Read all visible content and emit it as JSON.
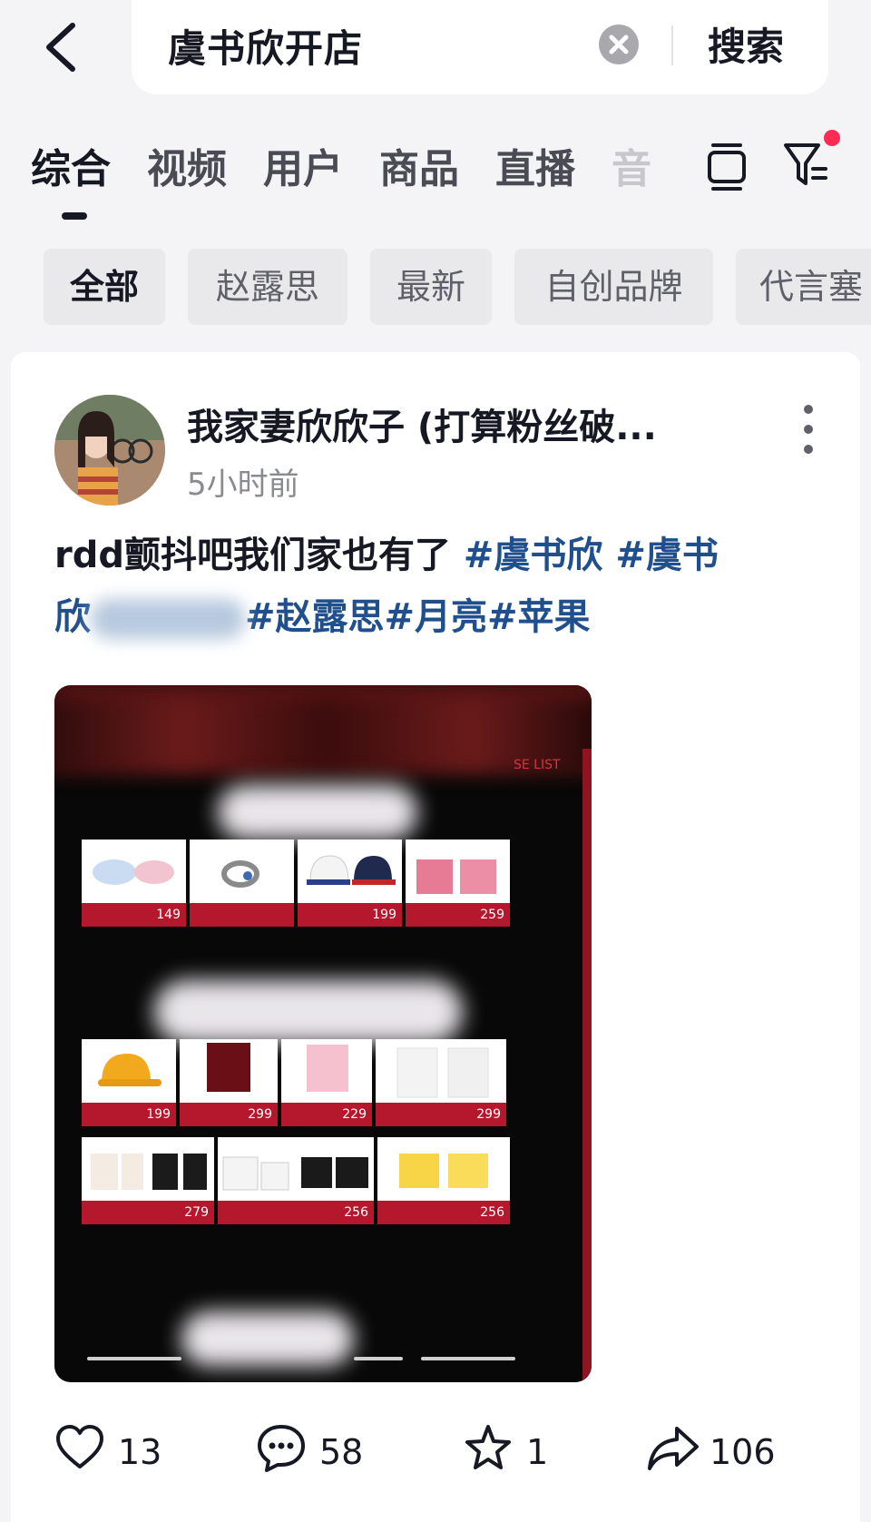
{
  "search": {
    "query": "虞书欣开店",
    "submit_label": "搜索"
  },
  "tabs": [
    {
      "label": "综合"
    },
    {
      "label": "视频"
    },
    {
      "label": "用户"
    },
    {
      "label": "商品"
    },
    {
      "label": "直播"
    },
    {
      "label": "音"
    }
  ],
  "chips": [
    {
      "label": "全部"
    },
    {
      "label": "赵露思"
    },
    {
      "label": "最新"
    },
    {
      "label": "自创品牌"
    },
    {
      "label": "代言塞"
    }
  ],
  "post": {
    "author": "我家妻欣欣子 (打算粉丝破...",
    "time": "5小时前",
    "text": "rdd颤抖吧我们家也有了 ",
    "tags": [
      "#虞书欣",
      "#虞书",
      "欣",
      "#赵露思",
      "#月亮",
      "#苹果"
    ],
    "image_label": "SE LIST",
    "products": {
      "row1": [
        {
          "price": "149"
        },
        {
          "price": ""
        },
        {
          "price": "199"
        },
        {
          "price": "259"
        }
      ],
      "row2": [
        {
          "price": "199"
        },
        {
          "price": "299"
        },
        {
          "price": "229"
        },
        {
          "price": "299"
        }
      ],
      "row3": [
        {
          "price": "279"
        },
        {
          "price": "256"
        },
        {
          "price": "256"
        }
      ]
    }
  },
  "actions": {
    "likes": "13",
    "comments": "58",
    "favorites": "1",
    "shares": "106"
  },
  "colors": {
    "accent": "#fe2c55",
    "hashtag": "#1f4f8d",
    "price_bar": "#b5172c"
  }
}
